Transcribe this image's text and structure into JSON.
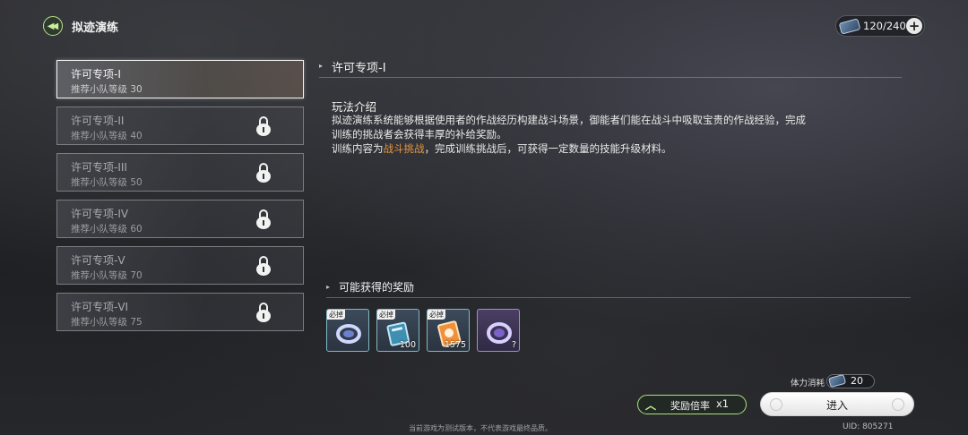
{
  "header": {
    "title": "拟迹演练",
    "stamina": "120/240"
  },
  "stages": [
    {
      "name": "许可专项-I",
      "level": "推荐小队等级 30",
      "locked": false,
      "selected": true
    },
    {
      "name": "许可专项-II",
      "level": "推荐小队等级 40",
      "locked": true,
      "selected": false
    },
    {
      "name": "许可专项-III",
      "level": "推荐小队等级 50",
      "locked": true,
      "selected": false
    },
    {
      "name": "许可专项-IV",
      "level": "推荐小队等级 60",
      "locked": true,
      "selected": false
    },
    {
      "name": "许可专项-V",
      "level": "推荐小队等级 70",
      "locked": true,
      "selected": false
    },
    {
      "name": "许可专项-VI",
      "level": "推荐小队等级 75",
      "locked": true,
      "selected": false
    }
  ],
  "detail": {
    "title": "许可专项-I",
    "intro_heading": "玩法介绍",
    "intro_line1": "拟迹演练系统能够根据使用者的作战经历构建战斗场景，御能者们能在战斗中吸取宝贵的作战经验，完成",
    "intro_line2": "训练的挑战者会获得丰厚的补给奖励。",
    "intro_line3_prefix": "训练内容为",
    "intro_line3_highlight": "战斗挑战",
    "intro_line3_suffix": "，完成训练挑战后，可获得一定数量的技能升级材料。",
    "highlight_color": "#e7963f"
  },
  "rewards": {
    "heading": "可能获得的奖励",
    "items": [
      {
        "icon": "ring-device-icon",
        "tag": "必掉",
        "count": "",
        "rarity": "blue"
      },
      {
        "icon": "book-icon",
        "tag": "必掉",
        "count": "100",
        "rarity": "blue"
      },
      {
        "icon": "coin-card-icon",
        "tag": "必掉",
        "count": "1575",
        "rarity": "blue"
      },
      {
        "icon": "ring-device-icon",
        "tag": "",
        "count": "?",
        "rarity": "purple"
      }
    ]
  },
  "controls": {
    "cost_label": "体力消耗",
    "cost_value": "20",
    "multiplier_label": "奖励倍率",
    "multiplier_value": "x1",
    "enter_label": "进入"
  },
  "footer": {
    "note": "当前游戏为测试版本，不代表游戏最终品质。",
    "uid": "UID: 805271"
  },
  "colors": {
    "accent": "#b8e28a"
  }
}
